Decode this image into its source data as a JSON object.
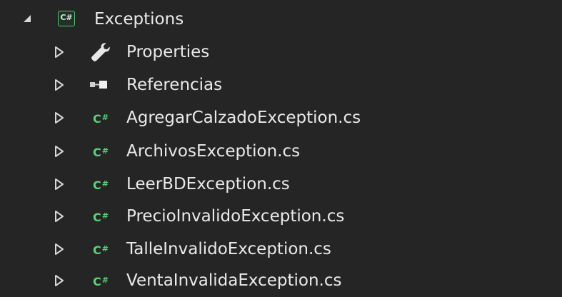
{
  "solution_explorer": {
    "project": {
      "expanded": true,
      "icon": "csharp-project-icon",
      "label": "Exceptions"
    },
    "items": [
      {
        "label": "Properties",
        "icon": "wrench-icon",
        "expanded": false
      },
      {
        "label": "Referencias",
        "icon": "references-icon",
        "expanded": false
      },
      {
        "label": "AgregarCalzadoException.cs",
        "icon": "csharp-file-icon",
        "expanded": false
      },
      {
        "label": "ArchivosException.cs",
        "icon": "csharp-file-icon",
        "expanded": false
      },
      {
        "label": "LeerBDException.cs",
        "icon": "csharp-file-icon",
        "expanded": false
      },
      {
        "label": "PrecioInvalidoException.cs",
        "icon": "csharp-file-icon",
        "expanded": false
      },
      {
        "label": "TalleInvalidoException.cs",
        "icon": "csharp-file-icon",
        "expanded": false
      },
      {
        "label": "VentaInvalidaException.cs",
        "icon": "csharp-file-icon",
        "expanded": false
      }
    ],
    "csharp_glyph": "C",
    "csharp_sharp": "#",
    "project_glyph": "C#"
  },
  "colors": {
    "background": "#252526",
    "text": "#eaeaea",
    "csharp_green": "#5fd07a",
    "arrow": "#d8d8d8"
  }
}
